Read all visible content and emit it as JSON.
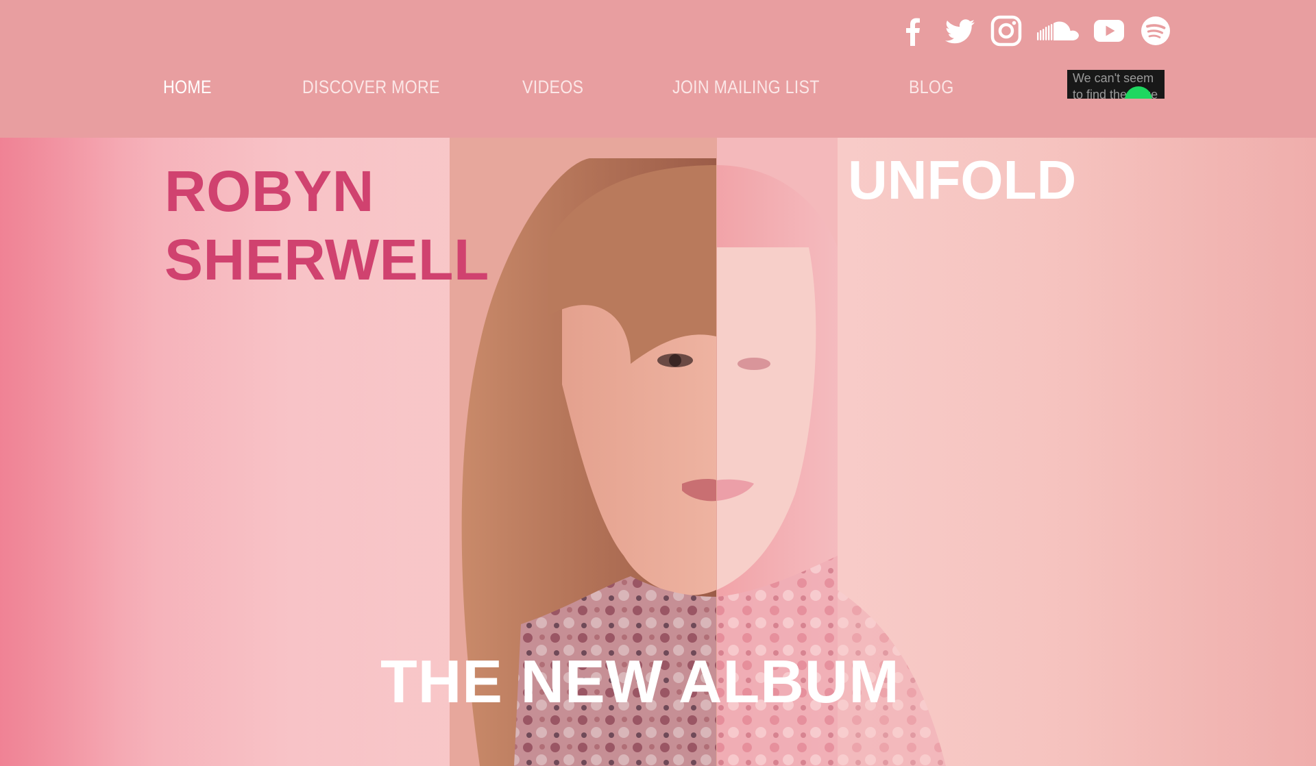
{
  "header": {
    "background": "#e89ea0",
    "socials": [
      {
        "name": "facebook-icon"
      },
      {
        "name": "twitter-icon"
      },
      {
        "name": "instagram-icon"
      },
      {
        "name": "soundcloud-icon"
      },
      {
        "name": "youtube-icon"
      },
      {
        "name": "spotify-icon"
      }
    ],
    "nav": [
      {
        "label": "HOME",
        "active": true
      },
      {
        "label": "DISCOVER MORE",
        "active": false
      },
      {
        "label": "VIDEOS",
        "active": false
      },
      {
        "label": "JOIN MAILING LIST",
        "active": false
      },
      {
        "label": "BLOG",
        "active": false
      }
    ],
    "spotify_widget": {
      "message": "We can't seem to find the page"
    }
  },
  "hero": {
    "artist_name": "ROBYN SHERWELL",
    "album_title": "UNFOLD",
    "tagline": "THE NEW ALBUM",
    "artist_name_color": "#d0426f",
    "title_color": "#ffffff"
  }
}
